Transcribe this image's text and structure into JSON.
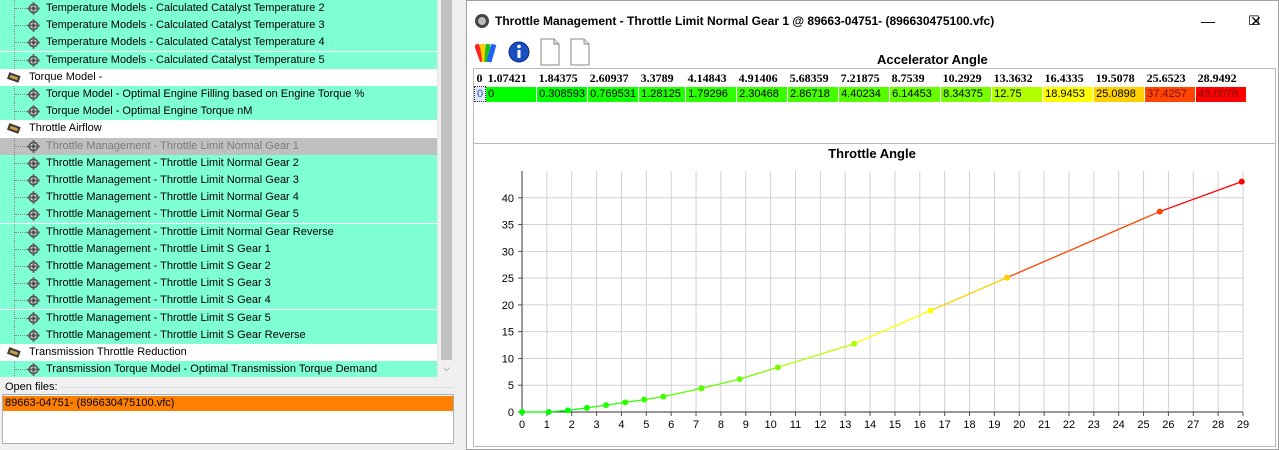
{
  "tree": {
    "items": [
      {
        "kind": "child",
        "label": "Temperature Models - Calculated Catalyst Temperature 2"
      },
      {
        "kind": "child",
        "label": "Temperature Models - Calculated Catalyst Temperature 3"
      },
      {
        "kind": "child",
        "label": "Temperature Models - Calculated Catalyst Temperature 4"
      },
      {
        "kind": "child",
        "label": "Temperature Models - Calculated Catalyst Temperature 5"
      },
      {
        "kind": "group",
        "label": "Torque Model -"
      },
      {
        "kind": "child",
        "label": "Torque Model - Optimal Engine Filling based on Engine Torque %"
      },
      {
        "kind": "child",
        "label": "Torque Model - Optimal Engine Torque nM"
      },
      {
        "kind": "group",
        "label": "Throttle Airflow"
      },
      {
        "kind": "selected",
        "label": "Throttle Management - Throttle Limit Normal Gear 1"
      },
      {
        "kind": "child",
        "label": "Throttle Management - Throttle Limit Normal Gear 2"
      },
      {
        "kind": "child",
        "label": "Throttle Management - Throttle Limit Normal Gear 3"
      },
      {
        "kind": "child",
        "label": "Throttle Management - Throttle Limit Normal Gear 4"
      },
      {
        "kind": "child",
        "label": "Throttle Management - Throttle Limit Normal Gear 5"
      },
      {
        "kind": "child",
        "label": "Throttle Management - Throttle Limit Normal Gear Reverse"
      },
      {
        "kind": "child",
        "label": "Throttle Management - Throttle Limit S Gear 1"
      },
      {
        "kind": "child",
        "label": "Throttle Management - Throttle Limit S Gear 2"
      },
      {
        "kind": "child",
        "label": "Throttle Management - Throttle Limit S Gear 3"
      },
      {
        "kind": "child",
        "label": "Throttle Management - Throttle Limit S Gear 4"
      },
      {
        "kind": "child",
        "label": "Throttle Management - Throttle Limit S Gear 5"
      },
      {
        "kind": "child",
        "label": "Throttle Management - Throttle Limit S Gear Reverse"
      },
      {
        "kind": "group",
        "label": "Transmission Throttle Reduction"
      },
      {
        "kind": "child",
        "label": "Transmission Torque Model - Optimal Transmission Torque Demand"
      }
    ]
  },
  "open_files": {
    "label": "Open files:",
    "items": [
      "89663-04751- (896630475100.vfc)"
    ]
  },
  "window": {
    "title": "Throttle Management - Throttle Limit Normal Gear 1 @ 89663-04751- (896630475100.vfc)",
    "minimize": "—",
    "maximize": "☐",
    "close": "✕"
  },
  "table": {
    "title": "Accelerator Angle",
    "header": [
      "0",
      "1.07421",
      "1.84375",
      "2.60937",
      "3.3789",
      "4.14843",
      "4.91406",
      "5.68359",
      "7.21875",
      "8.7539",
      "10.2929",
      "13.3632",
      "16.4335",
      "19.5078",
      "25.6523",
      "28.9492"
    ],
    "row_index": "0",
    "values": [
      "0",
      "0.308593",
      "0.769531",
      "1.28125",
      "1.79296",
      "2.30468",
      "2.86718",
      "4.40234",
      "6.14453",
      "8.34375",
      "12.75",
      "18.9453",
      "25.0898",
      "37.4257",
      "43.0078"
    ],
    "value_colors": [
      "#00ff00",
      "#00ff00",
      "#11ff00",
      "#22ff00",
      "#2bff00",
      "#38ff00",
      "#45ff00",
      "#55ff00",
      "#66ff00",
      "#77ff00",
      "#b2ff00",
      "#ffff00",
      "#ffd000",
      "#ff4500",
      "#ff0000"
    ]
  },
  "chart_data": {
    "type": "scatter",
    "title": "Throttle Angle",
    "x": [
      0,
      1.07421,
      1.84375,
      2.60937,
      3.3789,
      4.14843,
      4.91406,
      5.68359,
      7.21875,
      8.7539,
      10.2929,
      13.3632,
      16.4335,
      19.5078,
      25.6523,
      28.9492
    ],
    "y": [
      0,
      0,
      0.308593,
      0.769531,
      1.28125,
      1.79296,
      2.30468,
      2.86718,
      4.40234,
      6.14453,
      8.34375,
      12.75,
      18.9453,
      25.0898,
      37.4257,
      43.0078
    ],
    "point_colors": [
      "#00ff00",
      "#00ff00",
      "#00ff00",
      "#11ff00",
      "#22ff00",
      "#2bff00",
      "#38ff00",
      "#45ff00",
      "#55ff00",
      "#66ff00",
      "#77ff00",
      "#b2ff00",
      "#ffff00",
      "#ffd000",
      "#ff4500",
      "#ff0000"
    ],
    "xlim": [
      0,
      29
    ],
    "ylim": [
      0,
      45
    ],
    "xticks": [
      0,
      1,
      2,
      3,
      4,
      5,
      6,
      7,
      8,
      9,
      10,
      11,
      12,
      13,
      14,
      15,
      16,
      17,
      18,
      19,
      20,
      21,
      22,
      23,
      24,
      25,
      26,
      27,
      28,
      29
    ],
    "yticks": [
      0,
      5,
      10,
      15,
      20,
      25,
      30,
      35,
      40
    ],
    "grid": true
  }
}
